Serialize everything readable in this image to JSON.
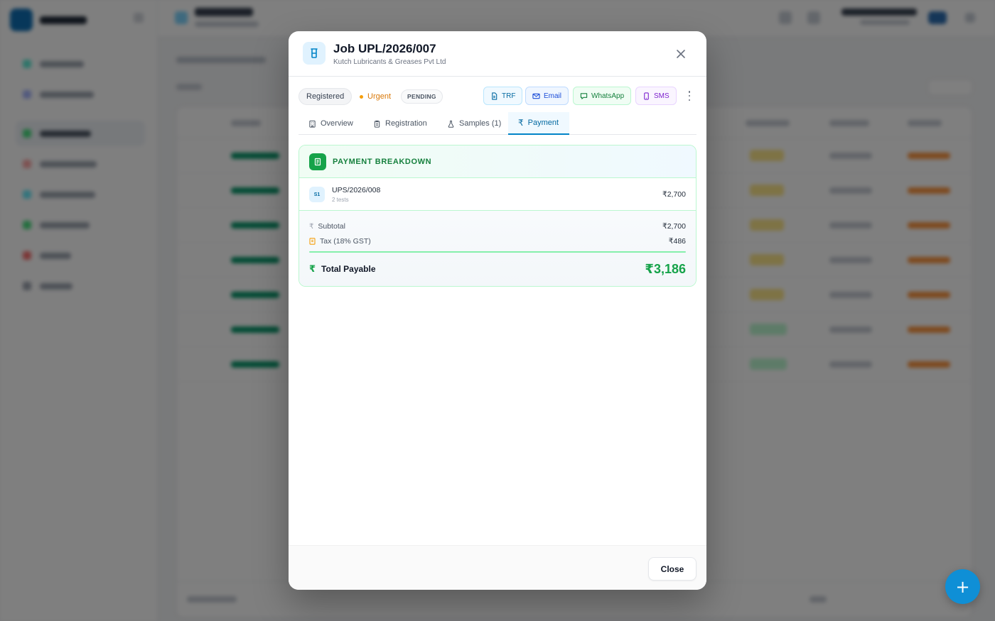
{
  "modal": {
    "title": "Job UPL/2026/007",
    "subtitle": "Kutch Lubricants & Greases Pvt Ltd",
    "status": {
      "registered": "Registered",
      "priority": "Urgent",
      "payment_state": "PENDING"
    },
    "actions": {
      "trf": "TRF",
      "email": "Email",
      "whatsapp": "WhatsApp",
      "sms": "SMS"
    },
    "tabs": [
      {
        "label": "Overview",
        "icon": "building-icon"
      },
      {
        "label": "Registration",
        "icon": "clipboard-icon"
      },
      {
        "label": "Samples (1)",
        "icon": "flask-icon"
      },
      {
        "label": "Payment",
        "icon": "rupee-icon",
        "active": true
      }
    ],
    "payment": {
      "heading": "PAYMENT BREAKDOWN",
      "items": [
        {
          "badge": "S1",
          "code": "UPS/2026/008",
          "tests": "2 tests",
          "amount": "₹2,700"
        }
      ],
      "subtotal_label": "Subtotal",
      "subtotal_value": "₹2,700",
      "tax_label": "Tax (18% GST)",
      "tax_value": "₹486",
      "total_label": "Total Payable",
      "total_value": "₹3,186"
    },
    "footer": {
      "close_label": "Close"
    }
  },
  "fab": {
    "label": "+"
  },
  "colors": {
    "accent": "#0f8fd6",
    "success": "#16a34a",
    "warning": "#d97706"
  }
}
